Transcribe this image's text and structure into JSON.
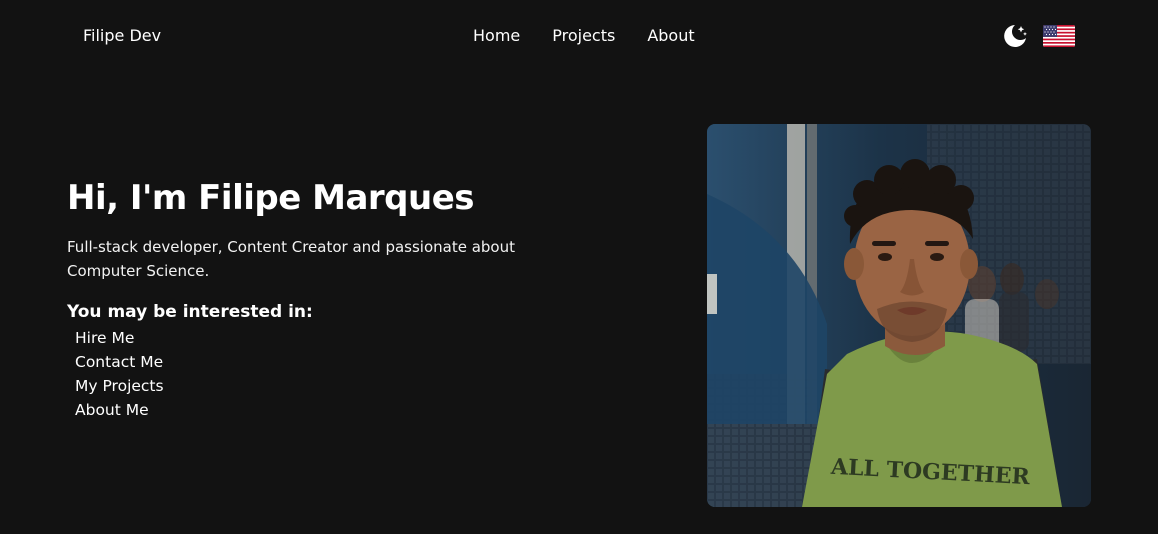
{
  "header": {
    "brand": "Filipe Dev",
    "nav": [
      "Home",
      "Projects",
      "About"
    ],
    "theme_icon": "moon-stars-icon",
    "language_icon": "us-flag-icon"
  },
  "hero": {
    "title": "Hi, I'm Filipe Marques",
    "subtitle": "Full-stack developer, Content Creator and passionate about Computer Science.",
    "interest_heading": "You may be interested in:",
    "links": [
      "Hire Me",
      "Contact Me",
      "My Projects",
      "About Me"
    ],
    "shirt_text": "ALL TOGETHER"
  },
  "colors": {
    "background": "#121212",
    "text": "#ffffff",
    "shirt": "#7f9a4a",
    "backdrop": "#1f3a52"
  }
}
